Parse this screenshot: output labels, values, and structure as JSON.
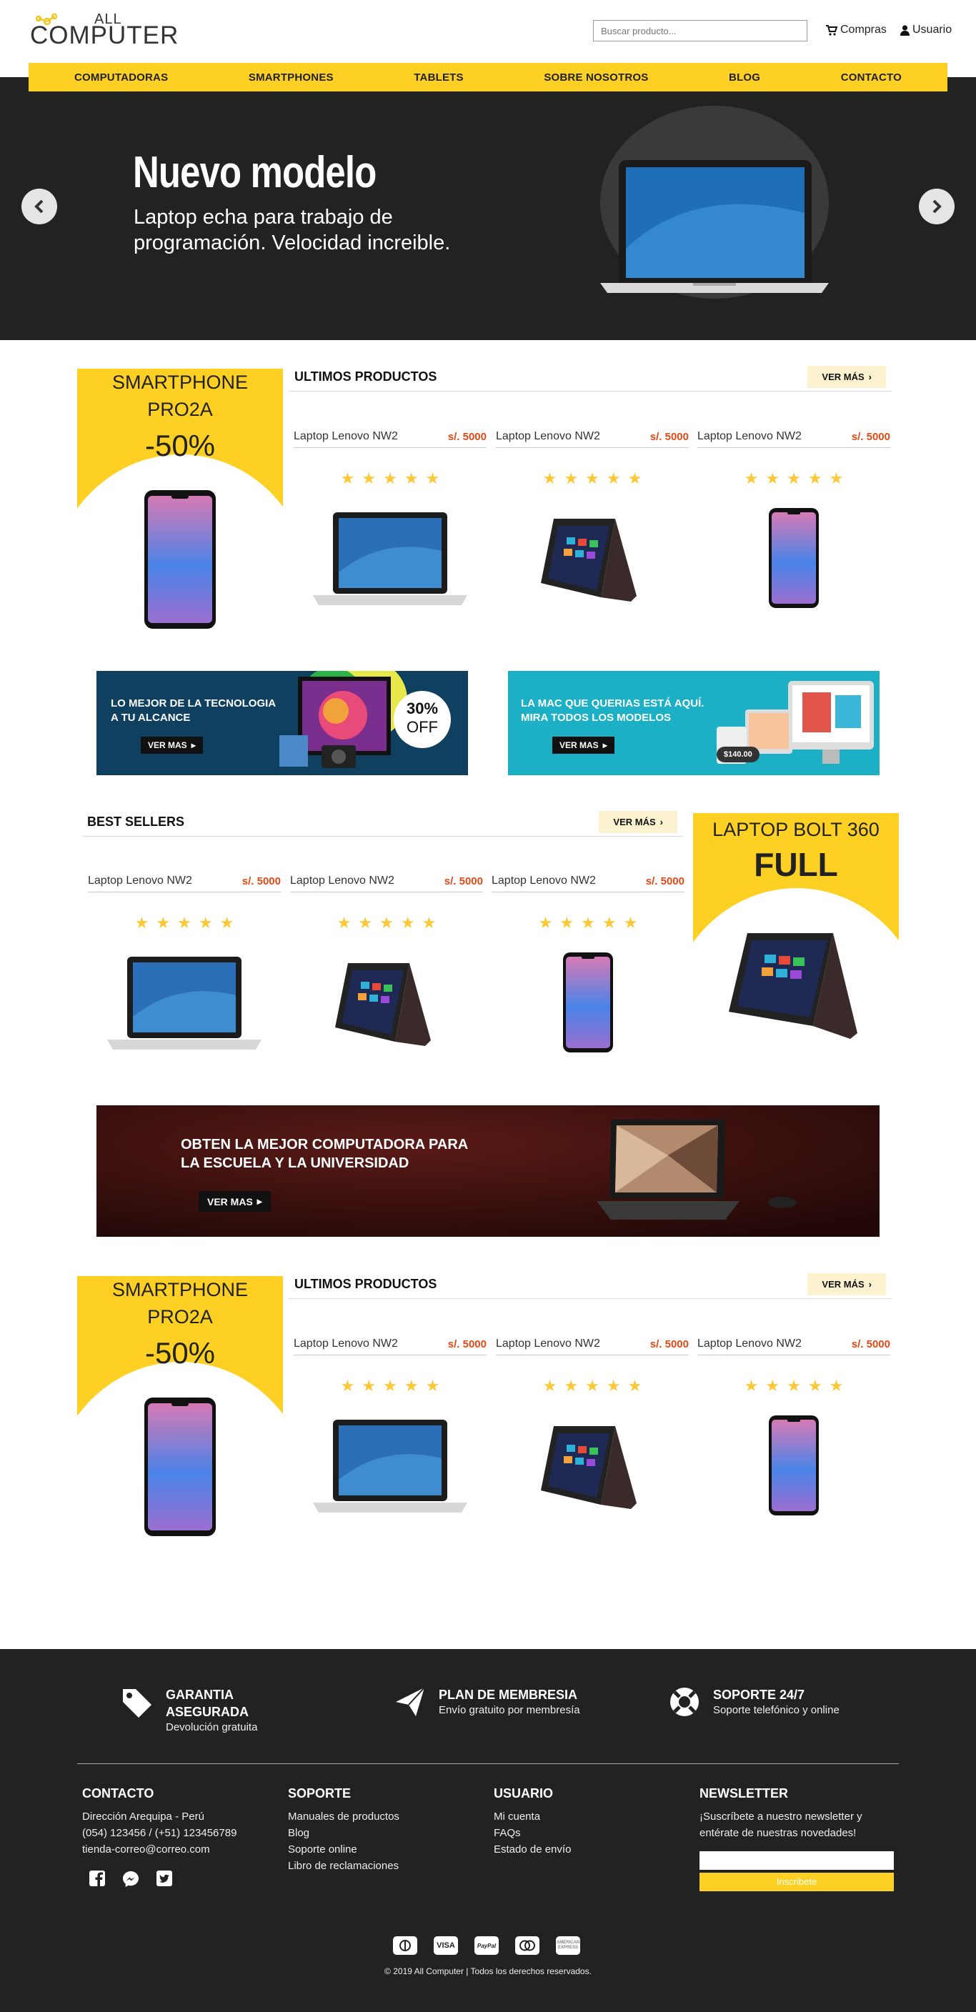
{
  "header": {
    "logo_top": "ALL",
    "logo_bottom": "COMPUTER",
    "search_placeholder": "Buscar producto...",
    "cart_label": "Compras",
    "user_label": "Usuario"
  },
  "nav": {
    "items": [
      "COMPUTADORAS",
      "SMARTPHONES",
      "TABLETS",
      "SOBRE NOSOTROS",
      "BLOG",
      "CONTACTO"
    ]
  },
  "hero": {
    "title": "Nuevo modelo",
    "subtitle": "Laptop echa para trabajo de programación. Velocidad increible."
  },
  "section1": {
    "promo_title_1": "SMARTPHONE",
    "promo_title_2": "PRO2A",
    "promo_discount": "-50%",
    "title": "ULTIMOS PRODUCTOS",
    "more_label": "VER MÁS",
    "products": [
      {
        "name": "Laptop Lenovo NW2",
        "price": "s/. 5000",
        "rating": 5,
        "image": "laptop"
      },
      {
        "name": "Laptop Lenovo NW2",
        "price": "s/. 5000",
        "rating": 5,
        "image": "tablet"
      },
      {
        "name": "Laptop Lenovo NW2",
        "price": "s/. 5000",
        "rating": 5,
        "image": "phone"
      }
    ]
  },
  "banners": {
    "left_line1": "LO MEJOR DE LA TECNOLOGIA",
    "left_line2": "A TU ALCANCE",
    "left_button": "VER MAS",
    "left_badge_pct": "30%",
    "left_badge_off": "OFF",
    "right_line1": "LA MAC QUE QUERIAS ESTÁ AQUÍ.",
    "right_line2": "MIRA TODOS LOS MODELOS",
    "right_button": "VER MAS",
    "right_price": "$140.00"
  },
  "section2": {
    "title": "BEST SELLERS",
    "more_label": "VER MÁS",
    "promo_title": "LAPTOP BOLT 360",
    "promo_sub": "FULL",
    "products": [
      {
        "name": "Laptop Lenovo NW2",
        "price": "s/. 5000",
        "rating": 5,
        "image": "laptop"
      },
      {
        "name": "Laptop Lenovo NW2",
        "price": "s/. 5000",
        "rating": 5,
        "image": "tablet"
      },
      {
        "name": "Laptop Lenovo NW2",
        "price": "s/. 5000",
        "rating": 5,
        "image": "phone"
      }
    ]
  },
  "wide_banner": {
    "line1": "OBTEN LA MEJOR COMPUTADORA PARA",
    "line2": "LA ESCUELA Y LA UNIVERSIDAD",
    "button": "VER MAS"
  },
  "section3": {
    "promo_title_1": "SMARTPHONE",
    "promo_title_2": "PRO2A",
    "promo_discount": "-50%",
    "title": "ULTIMOS PRODUCTOS",
    "more_label": "VER MÁS",
    "products": [
      {
        "name": "Laptop Lenovo NW2",
        "price": "s/. 5000",
        "rating": 5,
        "image": "laptop"
      },
      {
        "name": "Laptop Lenovo NW2",
        "price": "s/. 5000",
        "rating": 5,
        "image": "tablet"
      },
      {
        "name": "Laptop Lenovo NW2",
        "price": "s/. 5000",
        "rating": 5,
        "image": "phone"
      }
    ]
  },
  "footer": {
    "features": [
      {
        "icon": "tag-icon",
        "title_1": "GARANTIA",
        "title_2": "ASEGURADA",
        "sub": "Devolución gratuita"
      },
      {
        "icon": "paper-plane-icon",
        "title_1": "PLAN DE MEMBRESIA",
        "title_2": "",
        "sub": "Envío gratuito por membresía"
      },
      {
        "icon": "lifebuoy-icon",
        "title_1": "SOPORTE 24/7",
        "title_2": "",
        "sub": "Soporte telefónico y online"
      }
    ],
    "contact": {
      "title": "CONTACTO",
      "address": "Dirección Arequipa - Perú",
      "phones": "(054) 123456 / (+51) 123456789",
      "email": "tienda-correo@correo.com"
    },
    "support": {
      "title": "SOPORTE",
      "links": [
        "Manuales de productos",
        "Blog",
        "Soporte online",
        "Libro de reclamaciones"
      ]
    },
    "user": {
      "title": "USUARIO",
      "links": [
        "Mi cuenta",
        "FAQs",
        "Estado de envío"
      ]
    },
    "newsletter": {
      "title": "NEWSLETTER",
      "text": "¡Suscríbete a nuestro newsletter y entérate de nuestras novedades!",
      "button": "Inscribete"
    },
    "payments": [
      "Diners Club",
      "VISA",
      "PayPal",
      "MasterCard",
      "American Express"
    ],
    "copyright": "© 2019 All Computer | Todos los derechos reservados."
  },
  "colors": {
    "accent": "#fdd023",
    "dark": "#222222",
    "price": "#e04a18",
    "star": "#fdc735"
  }
}
